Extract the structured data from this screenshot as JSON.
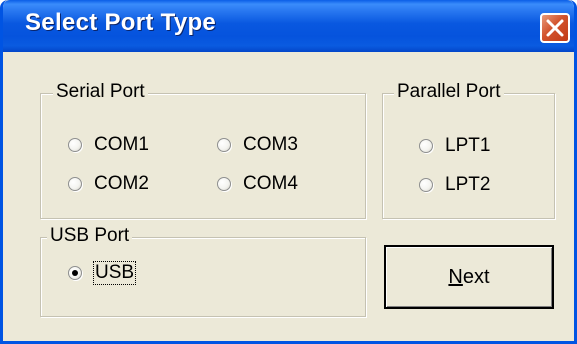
{
  "window": {
    "title": "Select Port Type"
  },
  "serial_port": {
    "legend": "Serial Port",
    "options": [
      "COM1",
      "COM3",
      "COM2",
      "COM4"
    ]
  },
  "parallel_port": {
    "legend": "Parallel Port",
    "options": [
      "LPT1",
      "LPT2"
    ]
  },
  "usb_port": {
    "legend": "USB Port",
    "option": "USB",
    "selected": true
  },
  "buttons": {
    "next_mnemonic": "N",
    "next_rest": "ext"
  },
  "colors": {
    "title_bar": "#0558df",
    "close_button": "#d2532d",
    "dialog_background": "#ece9d8"
  },
  "icons": {
    "close": "close-icon"
  }
}
